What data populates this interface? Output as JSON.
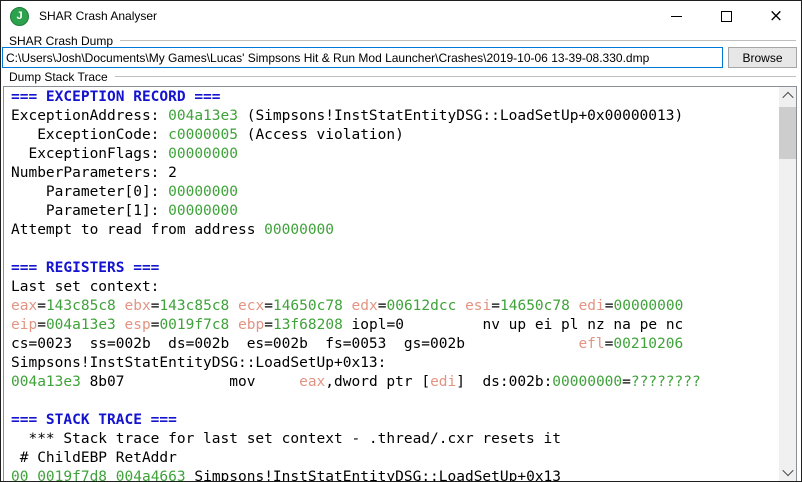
{
  "window": {
    "title": "SHAR Crash Analyser",
    "icon_letter": "J"
  },
  "crash_dump_group": {
    "label": "SHAR Crash Dump",
    "path": "C:\\Users\\Josh\\Documents\\My Games\\Lucas' Simpsons Hit & Run Mod Launcher\\Crashes\\2019-10-06 13-39-08.330.dmp",
    "browse_label": "Browse"
  },
  "stack_trace_group": {
    "label": "Dump Stack Trace"
  },
  "colors": {
    "section_header": "#1313d0",
    "hex_value": "#3fa23a",
    "register_name": "#e39482",
    "body_text": "#000000",
    "icon_green": "#2ca24c",
    "input_focus_border": "#0078d7"
  },
  "dump": {
    "lines": [
      [
        {
          "t": "=== EXCEPTION RECORD ===",
          "c": "b"
        }
      ],
      [
        {
          "t": "ExceptionAddress: "
        },
        {
          "t": "004a13e3",
          "c": "g"
        },
        {
          "t": " (Simpsons!InstStatEntityDSG::LoadSetUp+0x00000013)"
        }
      ],
      [
        {
          "t": "   ExceptionCode: "
        },
        {
          "t": "c0000005",
          "c": "g"
        },
        {
          "t": " (Access violation)"
        }
      ],
      [
        {
          "t": "  ExceptionFlags: "
        },
        {
          "t": "00000000",
          "c": "g"
        }
      ],
      [
        {
          "t": "NumberParameters: 2"
        }
      ],
      [
        {
          "t": "    Parameter[0]: "
        },
        {
          "t": "00000000",
          "c": "g"
        }
      ],
      [
        {
          "t": "    Parameter[1]: "
        },
        {
          "t": "00000000",
          "c": "g"
        }
      ],
      [
        {
          "t": "Attempt to read from address "
        },
        {
          "t": "00000000",
          "c": "g"
        }
      ],
      [],
      [
        {
          "t": "=== REGISTERS ===",
          "c": "b"
        }
      ],
      [
        {
          "t": "Last set context:"
        }
      ],
      [
        {
          "t": "eax",
          "c": "r"
        },
        {
          "t": "="
        },
        {
          "t": "143c85c8",
          "c": "g"
        },
        {
          "t": " "
        },
        {
          "t": "ebx",
          "c": "r"
        },
        {
          "t": "="
        },
        {
          "t": "143c85c8",
          "c": "g"
        },
        {
          "t": " "
        },
        {
          "t": "ecx",
          "c": "r"
        },
        {
          "t": "="
        },
        {
          "t": "14650c78",
          "c": "g"
        },
        {
          "t": " "
        },
        {
          "t": "edx",
          "c": "r"
        },
        {
          "t": "="
        },
        {
          "t": "00612dcc",
          "c": "g"
        },
        {
          "t": " "
        },
        {
          "t": "esi",
          "c": "r"
        },
        {
          "t": "="
        },
        {
          "t": "14650c78",
          "c": "g"
        },
        {
          "t": " "
        },
        {
          "t": "edi",
          "c": "r"
        },
        {
          "t": "="
        },
        {
          "t": "00000000",
          "c": "g"
        }
      ],
      [
        {
          "t": "eip",
          "c": "r"
        },
        {
          "t": "="
        },
        {
          "t": "004a13e3",
          "c": "g"
        },
        {
          "t": " "
        },
        {
          "t": "esp",
          "c": "r"
        },
        {
          "t": "="
        },
        {
          "t": "0019f7c8",
          "c": "g"
        },
        {
          "t": " "
        },
        {
          "t": "ebp",
          "c": "r"
        },
        {
          "t": "="
        },
        {
          "t": "13f68208",
          "c": "g"
        },
        {
          "t": " iopl=0         nv up ei pl nz na pe nc"
        }
      ],
      [
        {
          "t": "cs=0023  ss=002b  ds=002b  es=002b  fs=0053  gs=002b             "
        },
        {
          "t": "efl",
          "c": "r"
        },
        {
          "t": "="
        },
        {
          "t": "00210206",
          "c": "g"
        }
      ],
      [
        {
          "t": "Simpsons!InstStatEntityDSG::LoadSetUp+0x13:"
        }
      ],
      [
        {
          "t": "004a13e3",
          "c": "g"
        },
        {
          "t": " 8b07            mov     "
        },
        {
          "t": "eax",
          "c": "r"
        },
        {
          "t": ",dword ptr ["
        },
        {
          "t": "edi",
          "c": "r"
        },
        {
          "t": "]  ds:002b:"
        },
        {
          "t": "00000000",
          "c": "g"
        },
        {
          "t": "="
        },
        {
          "t": "????????",
          "c": "g"
        }
      ],
      [],
      [
        {
          "t": "=== STACK TRACE ===",
          "c": "b"
        }
      ],
      [
        {
          "t": "  *** Stack trace for last set context - .thread/.cxr resets it"
        }
      ],
      [
        {
          "t": " # ChildEBP RetAddr"
        }
      ],
      [
        {
          "t": "00",
          "c": "g"
        },
        {
          "t": " "
        },
        {
          "t": "0019f7d8",
          "c": "g"
        },
        {
          "t": " "
        },
        {
          "t": "004a4663",
          "c": "g"
        },
        {
          "t": " Simpsons!InstStatEntityDSG::LoadSetUp+0x13"
        }
      ]
    ]
  }
}
